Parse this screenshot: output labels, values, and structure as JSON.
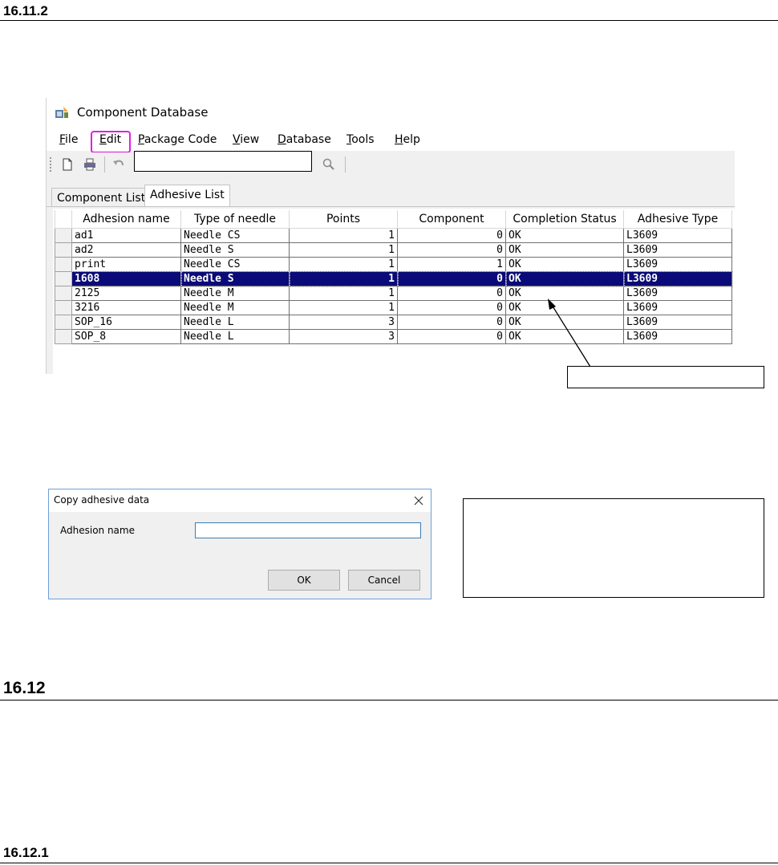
{
  "headings": {
    "h1": "16.11.2",
    "h2": "16.12",
    "h3": "16.12.1"
  },
  "window": {
    "title": "Component Database",
    "menu": [
      {
        "mnemonic": "F",
        "rest": "ile"
      },
      {
        "mnemonic": "E",
        "rest": "dit"
      },
      {
        "mnemonic": "P",
        "rest": "ackage Code"
      },
      {
        "mnemonic": "V",
        "rest": "iew"
      },
      {
        "mnemonic": "D",
        "rest": "atabase"
      },
      {
        "mnemonic": "T",
        "rest": "ools"
      },
      {
        "mnemonic": "H",
        "rest": "elp"
      }
    ],
    "tabs": {
      "inactive": "Component List",
      "active": "Adhesive List"
    },
    "grid": {
      "columns": [
        "Adhesion name",
        "Type of needle",
        "Points",
        "Component",
        "Completion Status",
        "Adhesive Type"
      ],
      "rows": [
        [
          "ad1",
          "Needle CS",
          "1",
          "0",
          "OK",
          "L3609"
        ],
        [
          "ad2",
          "Needle S",
          "1",
          "0",
          "OK",
          "L3609"
        ],
        [
          "print",
          "Needle CS",
          "1",
          "1",
          "OK",
          "L3609"
        ],
        [
          "1608",
          "Needle S",
          "1",
          "0",
          "OK",
          "L3609"
        ],
        [
          "2125",
          "Needle M",
          "1",
          "0",
          "OK",
          "L3609"
        ],
        [
          "3216",
          "Needle M",
          "1",
          "0",
          "OK",
          "L3609"
        ],
        [
          "SOP_16",
          "Needle L",
          "3",
          "0",
          "OK",
          "L3609"
        ],
        [
          "SOP_8",
          "Needle L",
          "3",
          "0",
          "OK",
          "L3609"
        ]
      ],
      "selected_row": "1608"
    }
  },
  "dialog": {
    "title": "Copy adhesive data",
    "label": "Adhesion name",
    "input_value": "",
    "ok": "OK",
    "cancel": "Cancel"
  },
  "colors": {
    "selection": "#0a0a78",
    "edit_highlight": "#e020e0",
    "input_border": "#3c7fb1"
  }
}
